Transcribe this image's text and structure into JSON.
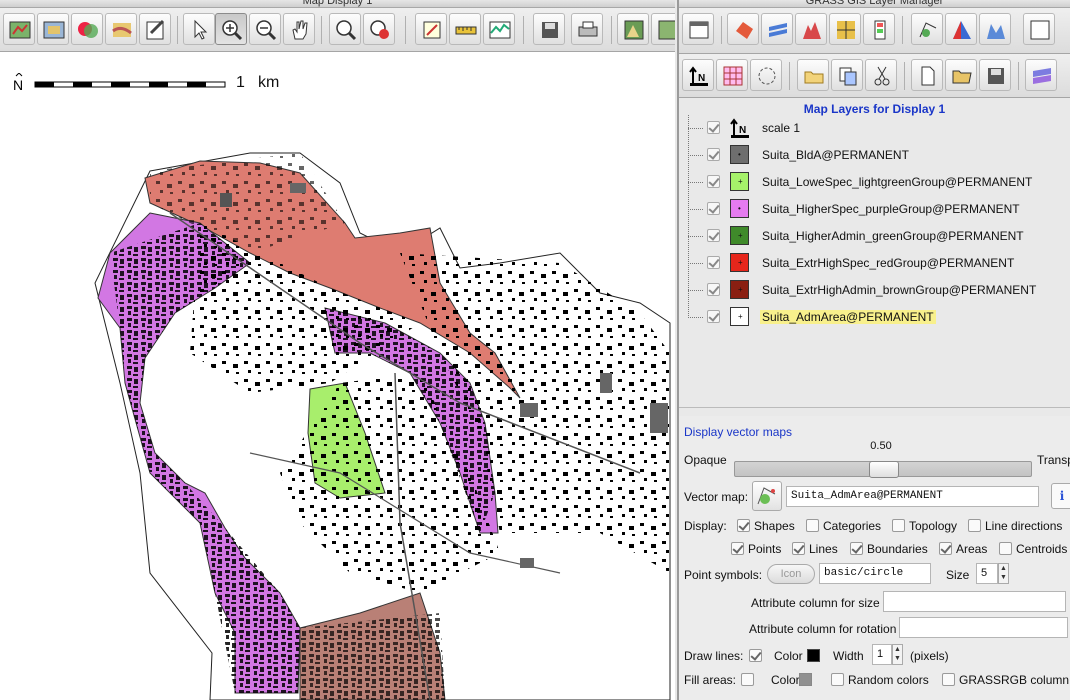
{
  "map_display": {
    "window_title": "Map Display 1",
    "scale_bar": {
      "label": "1",
      "unit": "km",
      "north_symbol": "N"
    }
  },
  "layer_manager": {
    "window_title": "GRASS GIS Layer Manager",
    "panel_title": "Map Layers for Display 1",
    "layers": [
      {
        "name": "scale 1",
        "type": "scale",
        "checked": true
      },
      {
        "name": "Suita_BldA@PERMANENT",
        "color": "#6e6e6e",
        "checked": true
      },
      {
        "name": "Suita_LoweSpec_lightgreenGroup@PERMANENT",
        "color": "#a6f26a",
        "checked": true
      },
      {
        "name": "Suita_HigherSpec_purpleGroup@PERMANENT",
        "color": "#e57bf0",
        "checked": true
      },
      {
        "name": "Suita_HigherAdmin_greenGroup@PERMANENT",
        "color": "#3f8a2a",
        "checked": true
      },
      {
        "name": "Suita_ExtrHighSpec_redGroup@PERMANENT",
        "color": "#e6261b",
        "checked": true
      },
      {
        "name": "Suita_ExtrHighAdmin_brownGroup@PERMANENT",
        "color": "#8a1f12",
        "checked": true
      },
      {
        "name": "Suita_AdmArea@PERMANENT",
        "color": "#ffffff",
        "checked": true,
        "selected": true
      }
    ],
    "properties": {
      "link": "Display vector maps",
      "opaque_label": "Opaque",
      "transparent_label": "Transp",
      "opacity_value": "0.50",
      "vector_map_label": "Vector map:",
      "vector_map_value": "Suita_AdmArea@PERMANENT",
      "display_label": "Display:",
      "display_options": [
        {
          "label": "Shapes",
          "checked": true
        },
        {
          "label": "Categories",
          "checked": false
        },
        {
          "label": "Topology",
          "checked": false
        },
        {
          "label": "Line directions",
          "checked": false
        }
      ],
      "display_options2": [
        {
          "label": "Points",
          "checked": true
        },
        {
          "label": "Lines",
          "checked": true
        },
        {
          "label": "Boundaries",
          "checked": true
        },
        {
          "label": "Areas",
          "checked": true
        },
        {
          "label": "Centroids",
          "checked": false
        }
      ],
      "point_symbols_label": "Point symbols:",
      "icon_button": "Icon",
      "symbol_value": "basic/circle",
      "size_label": "Size",
      "size_value": "5",
      "attr_size_label": "Attribute column for size",
      "attr_rotation_label": "Attribute column for rotation",
      "draw_lines_label": "Draw lines:",
      "color_label": "Color",
      "line_color": "#000000",
      "width_label": "Width",
      "width_value": "1",
      "pixels_label": "(pixels)",
      "fill_areas_label": "Fill areas:",
      "fill_color_label": "Color",
      "fill_color": "#909090",
      "random_colors_label": "Random colors",
      "grassrgb_label": "GRASSRGB column"
    }
  }
}
